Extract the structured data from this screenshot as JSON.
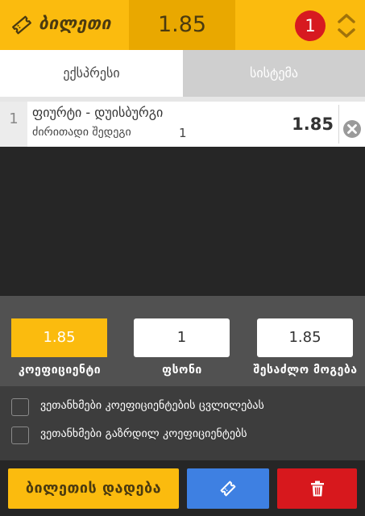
{
  "header": {
    "ticket_label": "ბილეთი",
    "total_odds": "1.85",
    "count_badge": "1",
    "ticket_icon": "ticket-icon",
    "expand_icon": "chevron-up-down-icon",
    "colors": {
      "bar": "#fbbb0e",
      "odds_bg": "#e9a800",
      "badge": "#d71920"
    }
  },
  "tabs": [
    {
      "label": "ექსპრესი",
      "active": true
    },
    {
      "label": "სისტემა",
      "active": false
    }
  ],
  "bets": [
    {
      "index": "1",
      "match": "ფიურტი - დუისბურგი",
      "market": "ძირითადი შედეგი",
      "pick": "1",
      "odds": "1.85",
      "remove_icon": "close-circle-icon"
    }
  ],
  "stake_panel": {
    "coefficient": "1.85",
    "stake": "1",
    "possible_win": "1.85",
    "coefficient_label": "კოეფიციენტი",
    "stake_label": "ფსონი",
    "possible_win_label": "შესაძლო მოგება"
  },
  "options": [
    {
      "label": "ვეთანხმები კოეფიციენტების ცვლილებას",
      "checked": false
    },
    {
      "label": "ვეთანხმები გაზრდილ კოეფიციენტებს",
      "checked": false
    }
  ],
  "actions": {
    "place_bet_label": "ბილეთის დადება",
    "ticket_icon": "ticket-icon",
    "delete_icon": "trash-icon",
    "colors": {
      "place": "#fbbb0e",
      "ticket": "#3e80e2",
      "delete": "#d7181d"
    }
  }
}
